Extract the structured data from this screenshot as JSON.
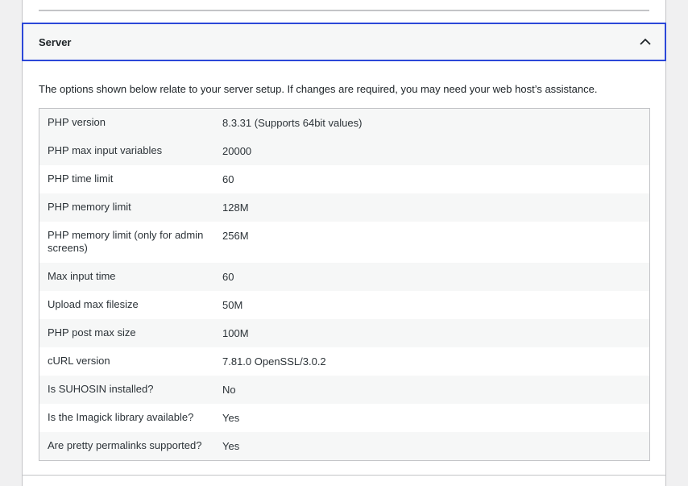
{
  "section": {
    "title": "Server",
    "description": "The options shown below relate to your server setup. If changes are required, you may need your web host’s assistance."
  },
  "icons": {
    "toggle": "chevron-up-icon"
  },
  "rows": [
    {
      "label": "PHP version",
      "value": "8.3.31 (Supports 64bit values)"
    },
    {
      "label": "PHP max input variables",
      "value": "20000"
    },
    {
      "label": "PHP time limit",
      "value": "60"
    },
    {
      "label": "PHP memory limit",
      "value": "128M"
    },
    {
      "label": "PHP memory limit (only for admin screens)",
      "value": "256M"
    },
    {
      "label": "Max input time",
      "value": "60"
    },
    {
      "label": "Upload max filesize",
      "value": "50M"
    },
    {
      "label": "PHP post max size",
      "value": "100M"
    },
    {
      "label": "cURL version",
      "value": "7.81.0 OpenSSL/3.0.2"
    },
    {
      "label": "Is SUHOSIN installed?",
      "value": "No"
    },
    {
      "label": "Is the Imagick library available?",
      "value": "Yes"
    },
    {
      "label": "Are pretty permalinks supported?",
      "value": "Yes"
    }
  ],
  "colors": {
    "focus_border": "#2c48d8",
    "stripe": "#f6f7f7",
    "border": "#c3c4c7"
  }
}
